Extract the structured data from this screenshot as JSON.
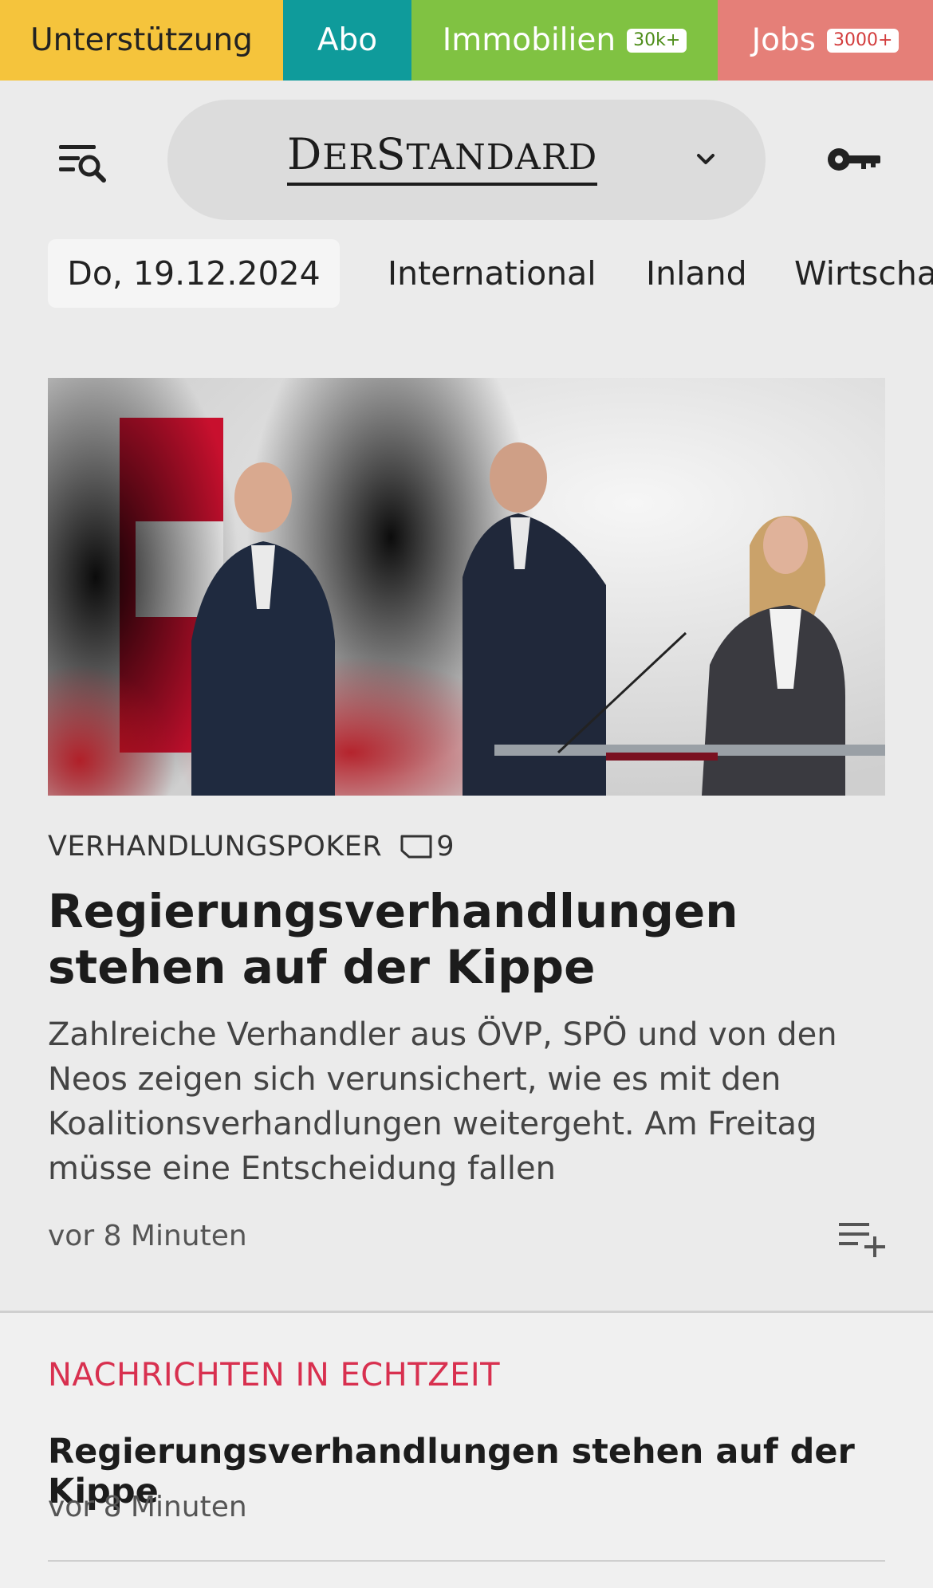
{
  "topbar": {
    "support_label": "Unterstützung",
    "abo_label": "Abo",
    "immo_label": "Immobilien",
    "immo_badge": "30k+",
    "jobs_label": "Jobs",
    "jobs_badge": "3000+"
  },
  "header": {
    "logo_text_big1": "D",
    "logo_text_small1": "ER",
    "logo_text_big2": "S",
    "logo_text_small2": "TANDARD"
  },
  "nav": {
    "date": "Do, 19.12.2024",
    "items": [
      "International",
      "Inland",
      "Wirtschaft"
    ]
  },
  "article": {
    "kicker": "VERHANDLUNGSPOKER",
    "comment_count": "9",
    "headline": "Regierungsverhandlungen stehen auf der Kippe",
    "lead": "Zahlreiche Verhandler aus ÖVP, SPÖ und von den Neos zeigen sich verunsichert, wie es mit den Koalitionsverhandlungen weitergeht. Am Freitag müsse eine Entscheidung fallen",
    "time": "vor 8 Minuten"
  },
  "realtime": {
    "label": "NACHRICHTEN IN ECHTZEIT",
    "headline": "Regierungsverhandlungen stehen auf der Kippe",
    "time": "vor 8 Minuten"
  },
  "colors": {
    "support": "#f5c43c",
    "abo": "#0f9b9b",
    "immo": "#80c242",
    "jobs": "#e57f78",
    "realtime_accent": "#d8304f"
  }
}
